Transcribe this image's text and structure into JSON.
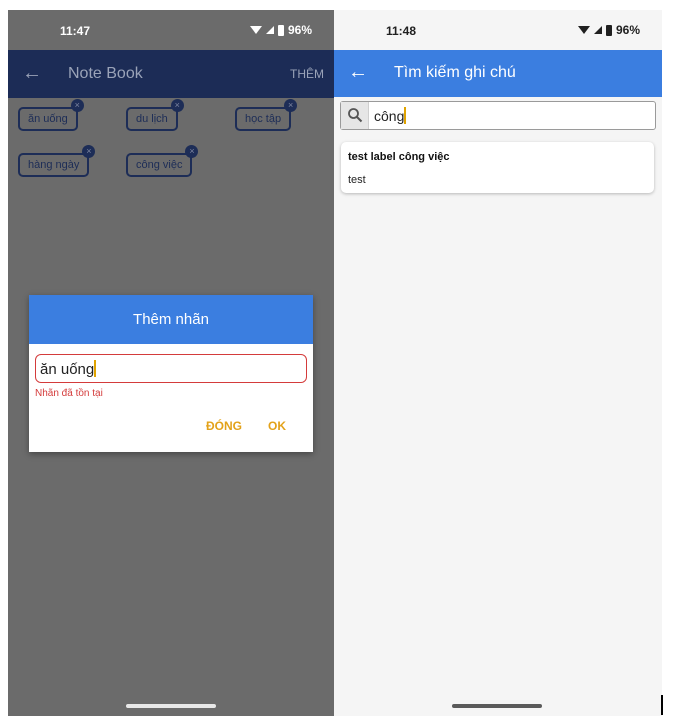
{
  "left": {
    "status": {
      "time": "11:47",
      "battery": "96%"
    },
    "appbar": {
      "back_icon": "←",
      "title": "Note Book",
      "action": "THÊM"
    },
    "labels": [
      {
        "text": "ăn uống",
        "badge": "×"
      },
      {
        "text": "du lịch",
        "badge": "×"
      },
      {
        "text": "học tập",
        "badge": "×"
      },
      {
        "text": "hàng ngày",
        "badge": "×"
      },
      {
        "text": "công việc",
        "badge": "×"
      }
    ],
    "dialog": {
      "title": "Thêm nhãn",
      "input_value": "ăn uống",
      "error": "Nhãn đã tồn tại",
      "close_label": "ĐÓNG",
      "ok_label": "OK"
    }
  },
  "right": {
    "status": {
      "time": "11:48",
      "battery": "96%"
    },
    "appbar": {
      "back_icon": "←",
      "title": "Tìm kiếm ghi chú"
    },
    "search": {
      "value": "công"
    },
    "results": [
      {
        "title": "test label công việc",
        "body": "test"
      }
    ]
  },
  "colors": {
    "accent": "#3b7ee0",
    "dim_appbar": "#1c2c56",
    "error": "#d43b3b",
    "dialog_button": "#e3a21a"
  }
}
